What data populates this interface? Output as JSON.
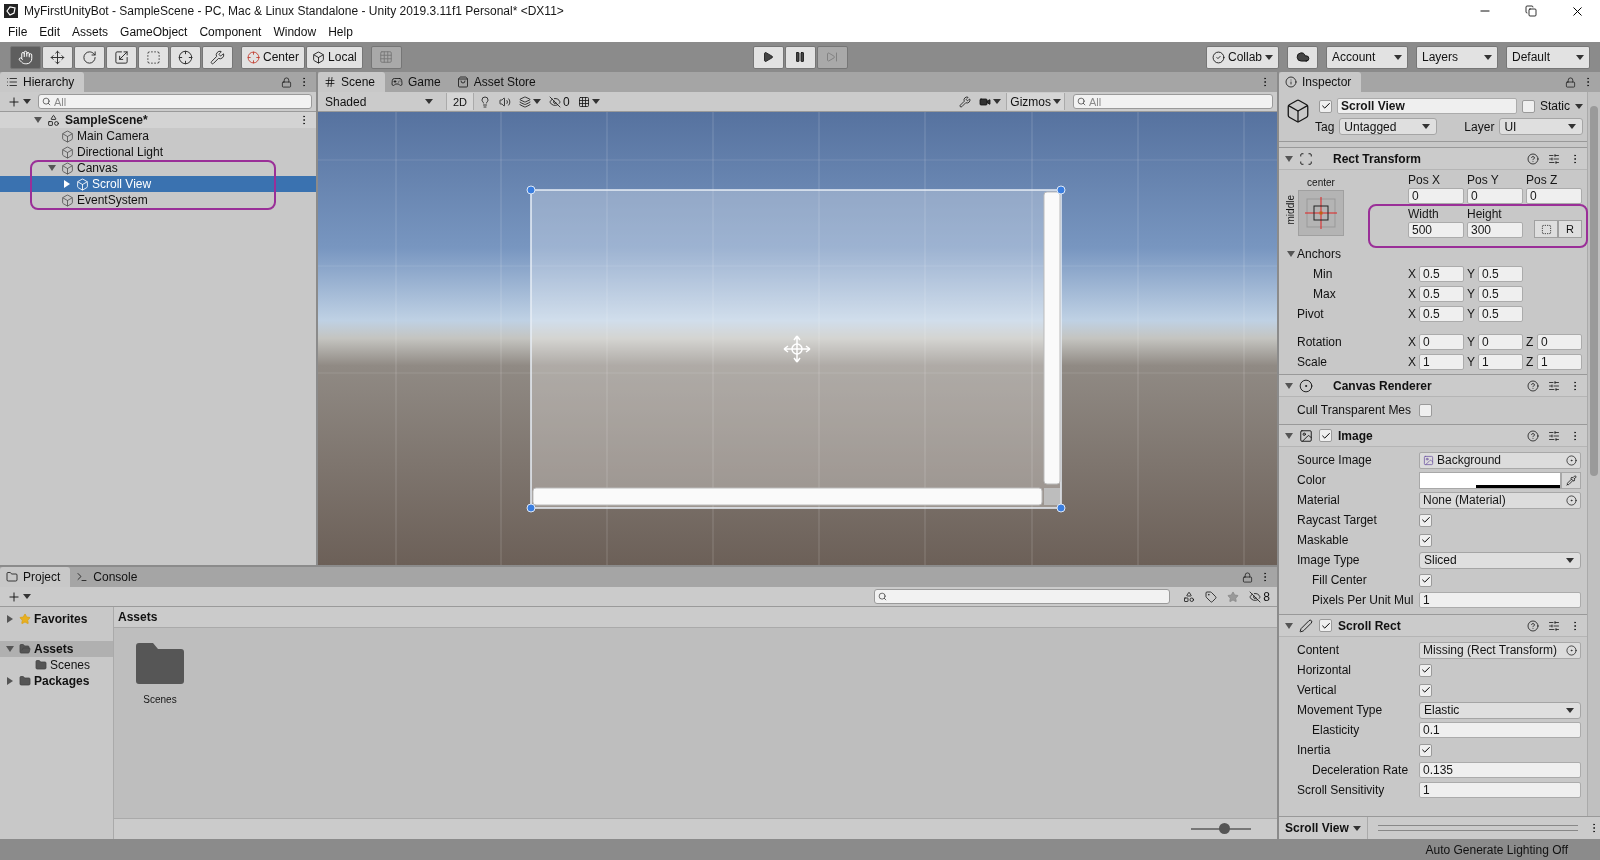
{
  "window": {
    "title": "MyFirstUnityBot - SampleScene - PC, Mac & Linux Standalone - Unity 2019.3.11f1 Personal* <DX11>"
  },
  "menu": [
    "File",
    "Edit",
    "Assets",
    "GameObject",
    "Component",
    "Window",
    "Help"
  ],
  "toolbar": {
    "tools": [
      {
        "kind": "hand",
        "selected": true
      },
      {
        "kind": "move",
        "selected": false
      },
      {
        "kind": "rotate",
        "selected": false
      },
      {
        "kind": "scale",
        "selected": false
      },
      {
        "kind": "rect",
        "selected": false
      },
      {
        "kind": "transform",
        "selected": false
      },
      {
        "kind": "custom",
        "selected": false
      }
    ],
    "pivot_buttons": [
      {
        "kind": "pivot",
        "label": "Center"
      },
      {
        "kind": "space",
        "label": "Local"
      }
    ],
    "collab": "Collab",
    "dropdowns": [
      "Account",
      "Layers",
      "Default"
    ]
  },
  "hierarchy": {
    "title": "Hierarchy",
    "search_placeholder": "All",
    "scene": {
      "label": "SampleScene*",
      "expanded": true
    },
    "items": [
      {
        "label": "Main Camera",
        "selected": false
      },
      {
        "label": "Directional Light",
        "selected": false
      },
      {
        "label": "Canvas",
        "selected": false,
        "expanded": true,
        "children": [
          {
            "label": "Scroll View",
            "selected": true,
            "expanded": false
          }
        ]
      },
      {
        "label": "EventSystem",
        "selected": false
      }
    ]
  },
  "scene_view": {
    "tabs": [
      {
        "kind": "scene",
        "label": "Scene",
        "selected": true
      },
      {
        "kind": "game",
        "label": "Game",
        "selected": false
      },
      {
        "kind": "store",
        "label": "Asset Store",
        "selected": false
      }
    ],
    "shading": "Shaded",
    "mode_2d": "2D",
    "hidden_count": "0",
    "gizmos": "Gizmos",
    "search_placeholder": "All"
  },
  "inspector": {
    "title": "Inspector",
    "object": {
      "name": "Scroll View",
      "active": true,
      "static_label": "Static",
      "static": false,
      "tag_label": "Tag",
      "tag": "Untagged",
      "layer_label": "Layer",
      "layer": "UI"
    },
    "components": [
      {
        "kind": "rect_transform",
        "title": "Rect Transform",
        "expanded": true,
        "anchor_preset": {
          "horizontal": "center",
          "vertical": "middle"
        },
        "position": [
          {
            "label": "Pos X",
            "value": "0"
          },
          {
            "label": "Pos Y",
            "value": "0"
          },
          {
            "label": "Pos Z",
            "value": "0"
          }
        ],
        "size": [
          {
            "label": "Width",
            "value": "500"
          },
          {
            "label": "Height",
            "value": "300"
          }
        ],
        "raw_edit_button": "R",
        "anchors": {
          "label": "Anchors",
          "expanded": true,
          "rows": [
            {
              "label": "Min",
              "axes": [
                "X",
                "Y"
              ],
              "values": [
                "0.5",
                "0.5"
              ]
            },
            {
              "label": "Max",
              "axes": [
                "X",
                "Y"
              ],
              "values": [
                "0.5",
                "0.5"
              ]
            }
          ]
        },
        "pivot": {
          "label": "Pivot",
          "axes": [
            "X",
            "Y"
          ],
          "values": [
            "0.5",
            "0.5"
          ]
        },
        "rotation": {
          "label": "Rotation",
          "axes": [
            "X",
            "Y",
            "Z"
          ],
          "values": [
            "0",
            "0",
            "0"
          ]
        },
        "scale": {
          "label": "Scale",
          "axes": [
            "X",
            "Y",
            "Z"
          ],
          "values": [
            "1",
            "1",
            "1"
          ]
        }
      },
      {
        "kind": "canvas_renderer",
        "title": "Canvas Renderer",
        "expanded": true,
        "properties": [
          {
            "kind": "checkbox",
            "label": "Cull Transparent Mes",
            "checked": false
          }
        ]
      },
      {
        "kind": "image",
        "title": "Image",
        "expanded": true,
        "enabled": true,
        "properties": [
          {
            "kind": "object",
            "label": "Source Image",
            "value": "Background",
            "sprite": true
          },
          {
            "kind": "color",
            "label": "Color",
            "color": "#ffffff"
          },
          {
            "kind": "object",
            "label": "Material",
            "value": "None (Material)"
          },
          {
            "kind": "checkbox",
            "label": "Raycast Target",
            "checked": true
          },
          {
            "kind": "checkbox",
            "label": "Maskable",
            "checked": true
          },
          {
            "kind": "dropdown",
            "label": "Image Type",
            "value": "Sliced",
            "children": [
              {
                "kind": "checkbox",
                "label": "Fill Center",
                "checked": true
              },
              {
                "kind": "field",
                "label": "Pixels Per Unit Mul",
                "value": "1"
              }
            ]
          }
        ]
      },
      {
        "kind": "scroll_rect",
        "title": "Scroll Rect",
        "expanded": true,
        "enabled": true,
        "properties": [
          {
            "kind": "object",
            "label": "Content",
            "value": "Missing (Rect Transform)"
          },
          {
            "kind": "checkbox",
            "label": "Horizontal",
            "checked": true
          },
          {
            "kind": "checkbox",
            "label": "Vertical",
            "checked": true
          },
          {
            "kind": "dropdown",
            "label": "Movement Type",
            "value": "Elastic",
            "children": [
              {
                "kind": "field",
                "label": "Elasticity",
                "value": "0.1"
              }
            ]
          },
          {
            "kind": "checkbox",
            "label": "Inertia",
            "checked": true,
            "children": [
              {
                "kind": "field",
                "label": "Deceleration Rate",
                "value": "0.135"
              }
            ]
          },
          {
            "kind": "field",
            "label": "Scroll Sensitivity",
            "value": "1"
          }
        ]
      }
    ],
    "footer": "Scroll View"
  },
  "project": {
    "tabs": [
      {
        "kind": "project",
        "label": "Project",
        "selected": true
      },
      {
        "kind": "console",
        "label": "Console",
        "selected": false
      }
    ],
    "hidden_count": "8",
    "sidebar": [
      {
        "kind": "favorites",
        "label": "Favorites",
        "expanded": false,
        "selected": false
      },
      {
        "kind": "folder",
        "label": "Assets",
        "expanded": true,
        "selected": true,
        "children": [
          {
            "kind": "folder",
            "label": "Scenes",
            "selected": false
          }
        ]
      },
      {
        "kind": "folder",
        "label": "Packages",
        "expanded": false,
        "selected": false
      }
    ],
    "path": "Assets",
    "items": [
      {
        "label": "Scenes"
      }
    ],
    "zoom": {
      "level": 0.55
    }
  },
  "status_bar": {
    "message": "Auto Generate Lighting Off"
  }
}
